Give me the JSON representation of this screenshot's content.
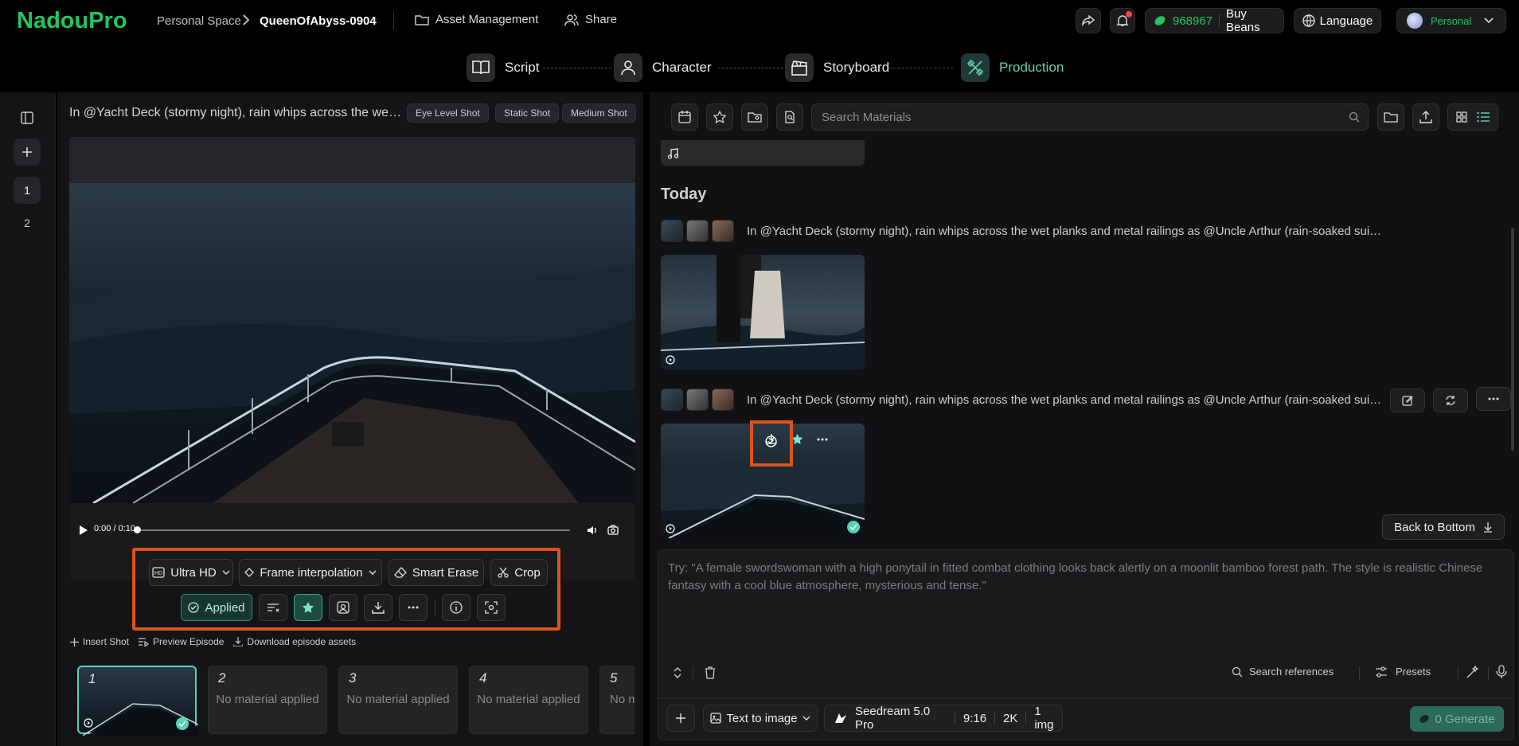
{
  "app": {
    "logo": "NadouPro"
  },
  "breadcrumb": {
    "space": "Personal Space",
    "project": "QueenOfAbyss-0904"
  },
  "topnav": {
    "assets": "Asset Management",
    "share": "Share"
  },
  "account": {
    "beans": "968967",
    "buy_label": "Buy Beans",
    "language": "Language",
    "workspace": "Personal"
  },
  "steps": [
    {
      "label": "Script"
    },
    {
      "label": "Character"
    },
    {
      "label": "Storyboard"
    },
    {
      "label": "Production"
    }
  ],
  "rail": {
    "pages": [
      "1",
      "2"
    ]
  },
  "shot": {
    "prompt": "In @Yacht Deck (stormy night), rain whips across the wet planks and metal railings as @Uncle Arthur (rain-soaked suit) looms",
    "tags": [
      "Eye Level Shot",
      "Static Shot",
      "Medium Shot"
    ]
  },
  "player": {
    "time": "0:00 / 0:10"
  },
  "tools": {
    "ultra_hd": "Ultra HD",
    "frame_interp": "Frame interpolation",
    "smart_erase": "Smart Erase",
    "crop": "Crop",
    "applied": "Applied"
  },
  "links": {
    "insert": "Insert Shot",
    "preview": "Preview Episode",
    "download": "Download episode assets"
  },
  "shots": [
    {
      "num": "1",
      "label": ""
    },
    {
      "num": "2",
      "label": "No material applied"
    },
    {
      "num": "3",
      "label": "No material applied"
    },
    {
      "num": "4",
      "label": "No material applied"
    },
    {
      "num": "5",
      "label": "No m"
    }
  ],
  "materials": {
    "search_placeholder": "Search Materials",
    "section": "Today",
    "row1": "In @Yacht Deck (stormy night), rain whips across the wet planks and metal railings as @Uncle Arthur (rain-soaked suit) looms ...",
    "row2": "In @Yacht Deck (stormy night), rain whips across the wet planks and metal railings as @Uncle Arthur (rain-soaked suit) looms ...",
    "back_to_bottom": "Back to Bottom"
  },
  "composer": {
    "placeholder": "Try: \"A female swordswoman with a high ponytail in fitted combat clothing looks back alertly on a moonlit bamboo forest path. The style is realistic Chinese fantasy with a cool blue atmosphere, mysterious and tense.\"",
    "search_refs": "Search references",
    "presets": "Presets",
    "mode": "Text to image",
    "model": "Seedream 5.0 Pro",
    "ratio": "9:16",
    "res": "2K",
    "count": "1 img",
    "generate": "0 Generate"
  },
  "colors": {
    "brand": "#22c55e",
    "accent": "#56d3b5",
    "highlight": "#d9541c"
  }
}
